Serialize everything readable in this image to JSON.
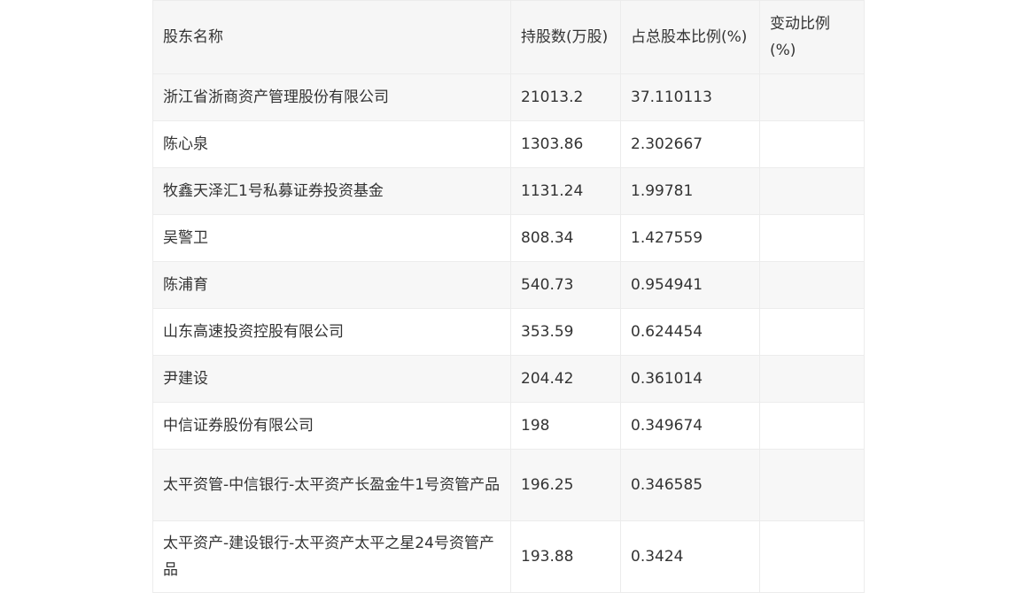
{
  "table": {
    "headers": [
      "股东名称",
      "持股数(万股)",
      "占总股本比例(%)",
      "变动比例(%)"
    ],
    "rows": [
      {
        "name": "浙江省浙商资产管理股份有限公司",
        "shares": "21013.2",
        "ratio": "37.110113",
        "change": ""
      },
      {
        "name": "陈心泉",
        "shares": "1303.86",
        "ratio": "2.302667",
        "change": ""
      },
      {
        "name": "牧鑫天泽汇1号私募证券投资基金",
        "shares": "1131.24",
        "ratio": "1.99781",
        "change": ""
      },
      {
        "name": "吴警卫",
        "shares": "808.34",
        "ratio": "1.427559",
        "change": ""
      },
      {
        "name": "陈浦育",
        "shares": "540.73",
        "ratio": "0.954941",
        "change": ""
      },
      {
        "name": "山东高速投资控股有限公司",
        "shares": "353.59",
        "ratio": "0.624454",
        "change": ""
      },
      {
        "name": "尹建设",
        "shares": "204.42",
        "ratio": "0.361014",
        "change": ""
      },
      {
        "name": "中信证券股份有限公司",
        "shares": "198",
        "ratio": "0.349674",
        "change": ""
      },
      {
        "name": "太平资管-中信银行-太平资产长盈金牛1号资管产品",
        "shares": "196.25",
        "ratio": "0.346585",
        "change": ""
      },
      {
        "name": "太平资产-建设银行-太平资产太平之星24号资管产品",
        "shares": "193.88",
        "ratio": "0.3424",
        "change": ""
      }
    ]
  }
}
